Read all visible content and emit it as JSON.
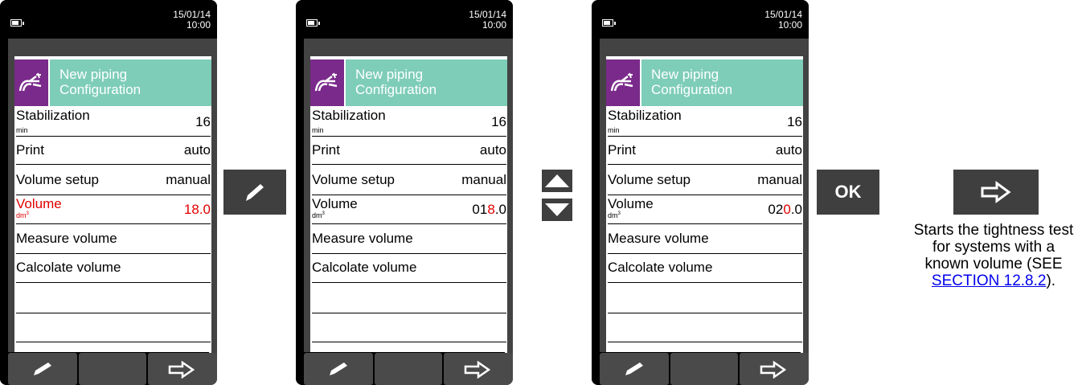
{
  "screens": [
    {
      "date": "15/01/14",
      "time": "10:00",
      "header": {
        "line1": "New piping",
        "line2": "Configuration"
      },
      "rows": [
        {
          "label": "Stabilization",
          "unit": "min",
          "value": "16"
        },
        {
          "label": "Print",
          "value": "auto"
        },
        {
          "label": "Volume setup",
          "value": "manual"
        },
        {
          "label": "Volume",
          "unit": "dm",
          "unit_sup": "3",
          "value": "18.0",
          "highlighted": true
        },
        {
          "label": "Measure volume"
        },
        {
          "label": "Calcolate volume"
        }
      ]
    },
    {
      "date": "15/01/14",
      "time": "10:00",
      "header": {
        "line1": "New piping",
        "line2": "Configuration"
      },
      "rows": [
        {
          "label": "Stabilization",
          "unit": "min",
          "value": "16"
        },
        {
          "label": "Print",
          "value": "auto"
        },
        {
          "label": "Volume setup",
          "value": "manual"
        },
        {
          "label": "Volume",
          "unit": "dm",
          "unit_sup": "3",
          "value_prefix": "01",
          "value_digit": "8",
          "value_suffix": ".0"
        },
        {
          "label": "Measure volume"
        },
        {
          "label": "Calcolate volume"
        }
      ]
    },
    {
      "date": "15/01/14",
      "time": "10:00",
      "header": {
        "line1": "New piping",
        "line2": "Configuration"
      },
      "rows": [
        {
          "label": "Stabilization",
          "unit": "min",
          "value": "16"
        },
        {
          "label": "Print",
          "value": "auto"
        },
        {
          "label": "Volume setup",
          "value": "manual"
        },
        {
          "label": "Volume",
          "unit": "dm",
          "unit_sup": "3",
          "value_prefix": "02",
          "value_digit": "0",
          "value_suffix": ".0"
        },
        {
          "label": "Measure volume"
        },
        {
          "label": "Calcolate volume"
        }
      ]
    }
  ],
  "keys": {
    "edit": "pencil-icon",
    "up": "arrow-up-icon",
    "down": "arrow-down-icon",
    "ok": "OK",
    "forward": "arrow-right-icon"
  },
  "description": {
    "text": "Starts the tightness test for systems with a known volume (SEE ",
    "link": "SECTION 12.8.2",
    "end": ")."
  },
  "colors": {
    "header_bg": "#7ecdb8",
    "icon_bg": "#7a2a8a",
    "highlight": "#e00000",
    "key_bg": "#3f3f3f"
  }
}
